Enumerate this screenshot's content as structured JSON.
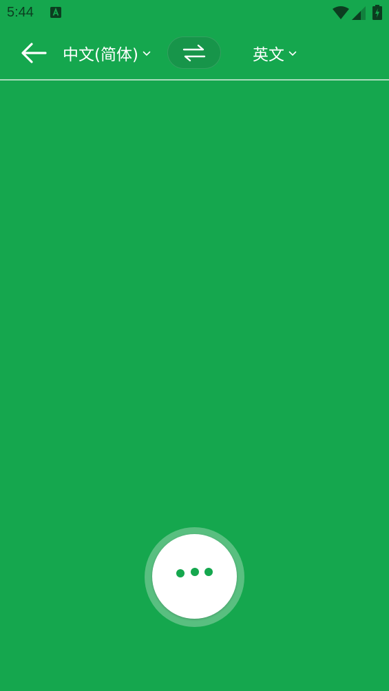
{
  "status_bar": {
    "time": "5:44",
    "icons": [
      "a-notification-icon",
      "wifi-icon",
      "signal-icon",
      "battery-charging-icon"
    ]
  },
  "toolbar": {
    "back_icon": "arrow-left-icon",
    "source_language": "中文(简体)",
    "target_language": "英文",
    "swap_icon": "swap-arrows-icon"
  },
  "listening_button": {
    "icon": "three-dots-icon"
  },
  "colors": {
    "background": "#15a74e",
    "swap_button": "#17954a",
    "halo": "#59bf80",
    "mic_button": "#ffffff",
    "status_text": "#0c3d20"
  }
}
